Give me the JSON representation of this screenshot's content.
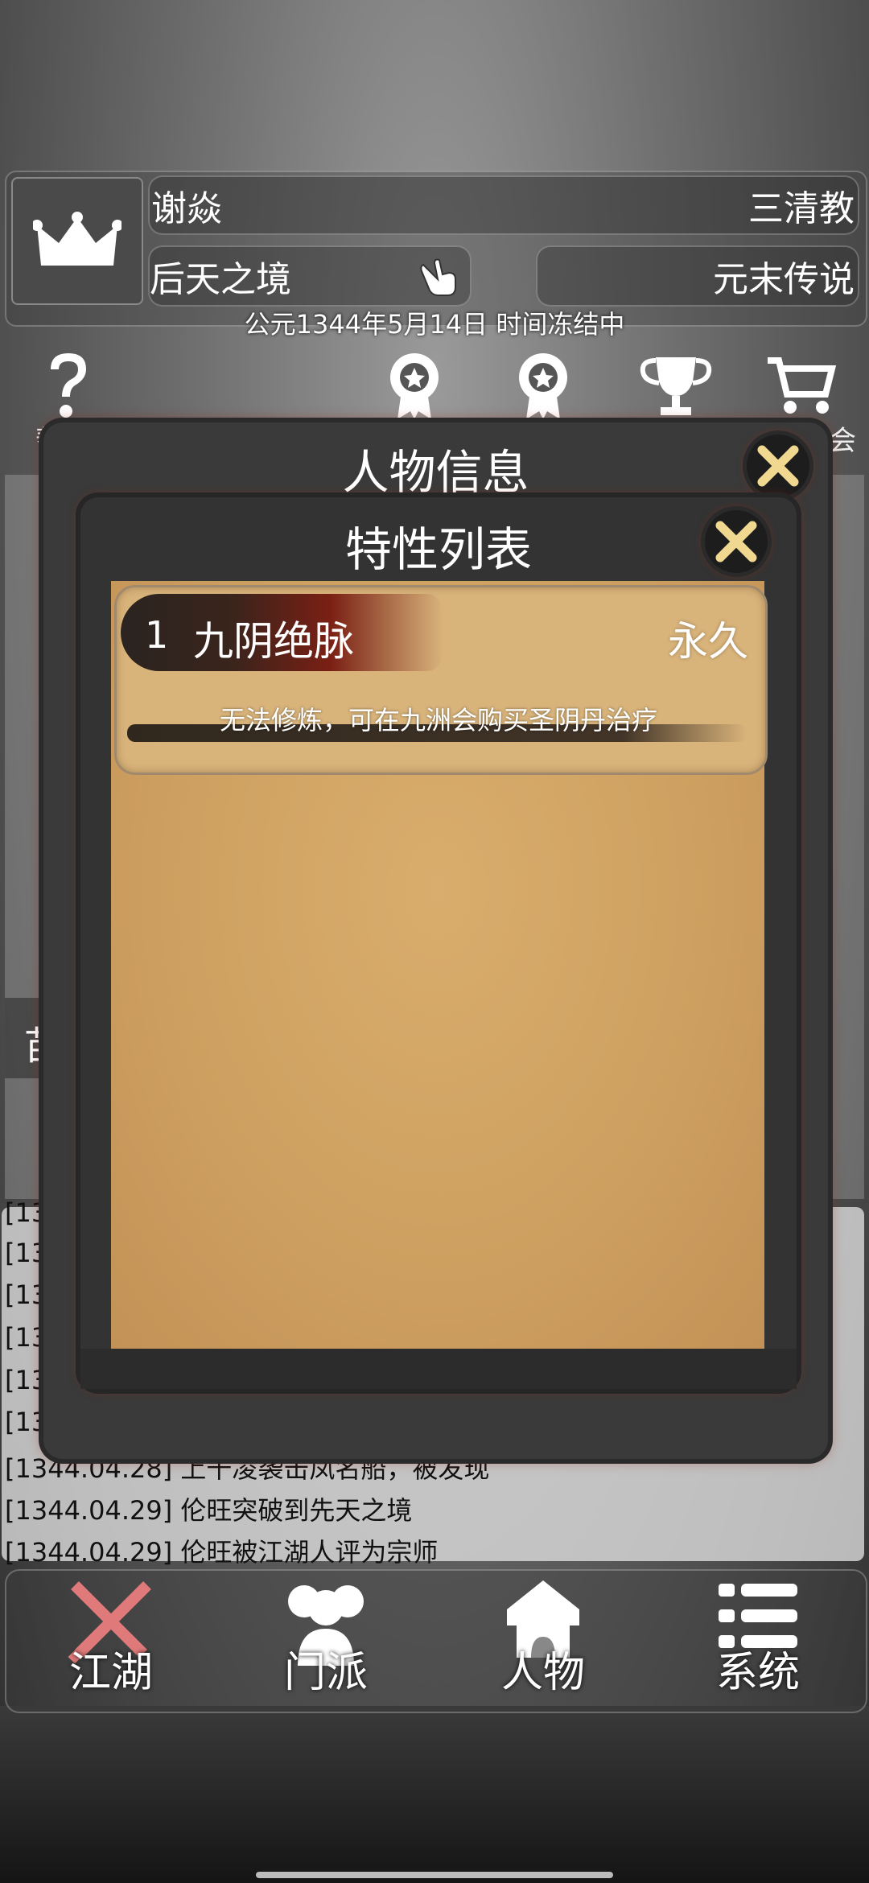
{
  "header": {
    "name": "谢焱",
    "sect": "三清教",
    "realm": "后天之境",
    "scenario": "元末传说",
    "date_status": "公元1344年5月14日 时间冻结中"
  },
  "icon_row": {
    "help_label": "帮",
    "right_label": "会"
  },
  "map": {
    "side_label": "苗"
  },
  "log": {
    "lines": [
      "[13",
      "[13",
      "[13",
      "[13",
      "[13",
      "[13",
      "[1344.04.28] 上千凌袭击凤名船，被发现",
      "[1344.04.29] 伦旺突破到先天之境",
      "[1344.04.29] 伦旺被江湖人评为宗师"
    ]
  },
  "dialog_character": {
    "title": "人物信息"
  },
  "dialog_traits": {
    "title": "特性列表",
    "traits": [
      {
        "index": "1",
        "name": "九阴绝脉",
        "duration": "永久",
        "description": "无法修炼，可在九洲会购买圣阴丹治疗"
      }
    ]
  },
  "nav": {
    "items": [
      {
        "label": "江湖",
        "icon": "crossed-swords-icon"
      },
      {
        "label": "门派",
        "icon": "people-icon"
      },
      {
        "label": "人物",
        "icon": "person-icon"
      },
      {
        "label": "系统",
        "icon": "menu-list-icon"
      }
    ]
  },
  "colors": {
    "accent_close": "#f0d890",
    "parchment": "#cfa262",
    "brush_red": "#7a1f14"
  }
}
